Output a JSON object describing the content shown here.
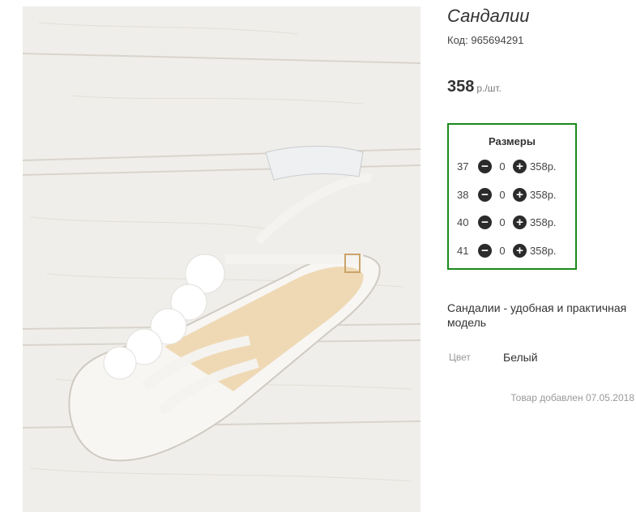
{
  "product": {
    "title": "Сандалии",
    "code_label": "Код:",
    "code": "965694291",
    "price": "358",
    "price_unit": "р./шт.",
    "description": "Сандалии - удобная и практичная модель",
    "color_label": "Цвет",
    "color_value": "Белый",
    "added_label": "Товар добавлен",
    "added_date": "07.05.2018"
  },
  "sizes": {
    "title": "Размеры",
    "rows": [
      {
        "size": "37",
        "qty": "0",
        "price": "358р."
      },
      {
        "size": "38",
        "qty": "0",
        "price": "358р."
      },
      {
        "size": "40",
        "qty": "0",
        "price": "358р."
      },
      {
        "size": "41",
        "qty": "0",
        "price": "358р."
      }
    ],
    "minus_symbol": "−",
    "plus_symbol": "+"
  },
  "colors": {
    "border_green": "#1a8a1a",
    "button_dark": "#2b2b2b"
  },
  "icons": [
    "minus-circle-icon",
    "plus-circle-icon"
  ]
}
